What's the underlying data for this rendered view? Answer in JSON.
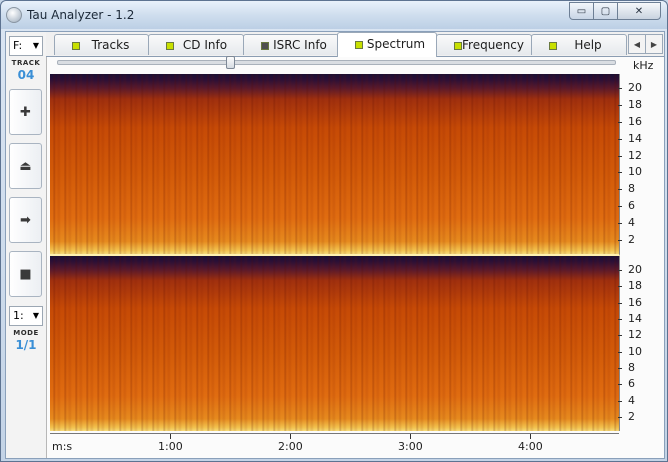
{
  "window": {
    "title": "Tau Analyzer - 1.2",
    "buttons": {
      "minimize": "▭",
      "maximize": "▢",
      "close": "✕"
    }
  },
  "left": {
    "drive": "F:",
    "track_label": "TRACK",
    "track_value": "04",
    "controls": [
      {
        "name": "add",
        "glyph": "✚"
      },
      {
        "name": "eject",
        "glyph": "⏏"
      },
      {
        "name": "play",
        "glyph": "➡"
      },
      {
        "name": "stop",
        "glyph": "■"
      }
    ],
    "mode_select": "1:",
    "mode_label": "MODE",
    "mode_value": "1/1"
  },
  "tabs": [
    {
      "label": "Tracks",
      "led": "#c8e000",
      "active": false
    },
    {
      "label": "CD Info",
      "led": "#c8e000",
      "active": false
    },
    {
      "label": "ISRC Info",
      "led": "#505050",
      "active": false
    },
    {
      "label": "Spectrum",
      "led": "#c8e000",
      "active": true
    },
    {
      "label": "Frequency",
      "led": "#c8e000",
      "active": false
    },
    {
      "label": "Help",
      "led": "#c8e000",
      "active": false
    }
  ],
  "slider": {
    "value": 0.31
  },
  "freq_unit": "kHz",
  "freq_ticks": [
    "20",
    "18",
    "16",
    "14",
    "12",
    "10",
    "8",
    "6",
    "4",
    "2"
  ],
  "time_axis": {
    "unit": "m:s",
    "ticks": [
      "1:00",
      "2:00",
      "3:00",
      "4:00"
    ]
  }
}
